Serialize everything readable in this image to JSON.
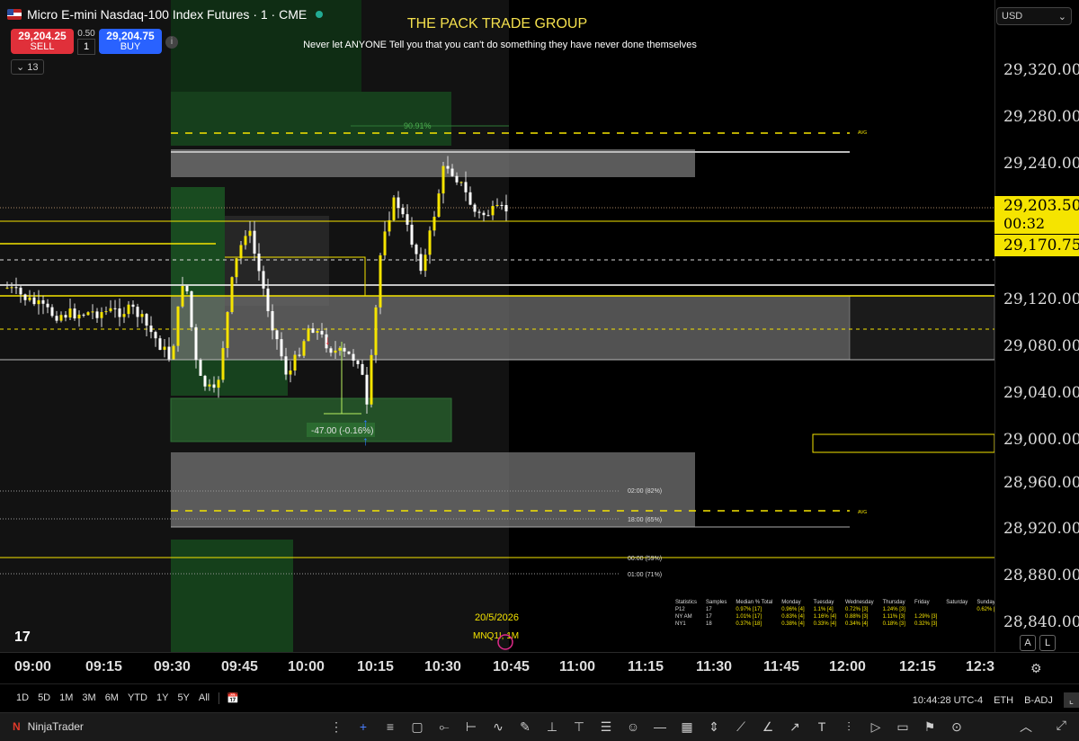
{
  "header": {
    "symbol_title": "Micro E-mini Nasdaq-100 Index Futures · 1 · CME",
    "sell_price": "29,204.25",
    "sell_label": "SELL",
    "buy_price": "29,204.75",
    "buy_label": "BUY",
    "spread": "0.50",
    "quantity": "1",
    "indicators_count": "13"
  },
  "banner": {
    "title": "THE PACK TRADE GROUP",
    "subtitle": "Never let ANYONE Tell you that you can't do something they have never done themselves"
  },
  "annotations": {
    "pct_label": "90.91%",
    "avg_top": "AVG",
    "avg_bottom": "AVG",
    "measure_label": "-47.00 (-0.16%)",
    "level_0200": "02:00 (82%)",
    "level_1800": "18:00 (65%)",
    "level_0000": "00:00 (59%)",
    "level_0100": "01:00 (71%)",
    "date_watermark": "20/5/2026",
    "symbol_watermark": "MNQ1!, 1M"
  },
  "stats_table": {
    "headers": [
      "Statistics",
      "Samples",
      "Median % Total",
      "Monday",
      "Tuesday",
      "Wednesday",
      "Thursday",
      "Friday",
      "Saturday",
      "Sunday"
    ],
    "rows": [
      [
        "P12",
        "17",
        "0.97% [17]",
        "0.96% [4]",
        "1.1% [4]",
        "0.72% [3]",
        "1.24% [3]",
        "",
        "",
        "0.62% [3]"
      ],
      [
        "NY AM",
        "17",
        "1.01% [17]",
        "0.83% [4]",
        "1.16% [4]",
        "0.88% [3]",
        "1.11% [3]",
        "1.29% [3]",
        "",
        ""
      ],
      [
        "NY1",
        "18",
        "0.37% [18]",
        "0.38% [4]",
        "0.33% [4]",
        "0.34% [4]",
        "0.18% [3]",
        "0.32% [3]",
        "",
        ""
      ]
    ]
  },
  "price_axis": {
    "currency": "USD",
    "labels": [
      "29,320.00",
      "29,280.00",
      "29,240.00",
      "29,120.00",
      "29,080.00",
      "29,040.00",
      "29,000.00",
      "28,960.00",
      "28,920.00",
      "28,880.00",
      "28,840.00"
    ],
    "current_price": "29,203.50",
    "countdown": "00:32",
    "marker_price": "29,170.75",
    "auto_label": "A",
    "log_label": "L"
  },
  "time_axis": {
    "labels": [
      "09:00",
      "09:15",
      "09:30",
      "09:45",
      "10:00",
      "10:15",
      "10:30",
      "10:45",
      "11:00",
      "11:15",
      "11:30",
      "11:45",
      "12:00",
      "12:15",
      "12:3"
    ]
  },
  "range_bar": {
    "ranges": [
      "1D",
      "5D",
      "1M",
      "3M",
      "6M",
      "YTD",
      "1Y",
      "5Y",
      "All"
    ],
    "clock": "10:44:28 UTC-4",
    "session": "ETH",
    "adjust": "B-ADJ"
  },
  "bottom_bar": {
    "app_name": "NinjaTrader"
  },
  "colors": {
    "accent": "#f5e400",
    "sell": "#e0303a",
    "buy": "#2962ff",
    "zone_green": "#1f5a2a",
    "zone_grey": "#5a5a5a"
  }
}
